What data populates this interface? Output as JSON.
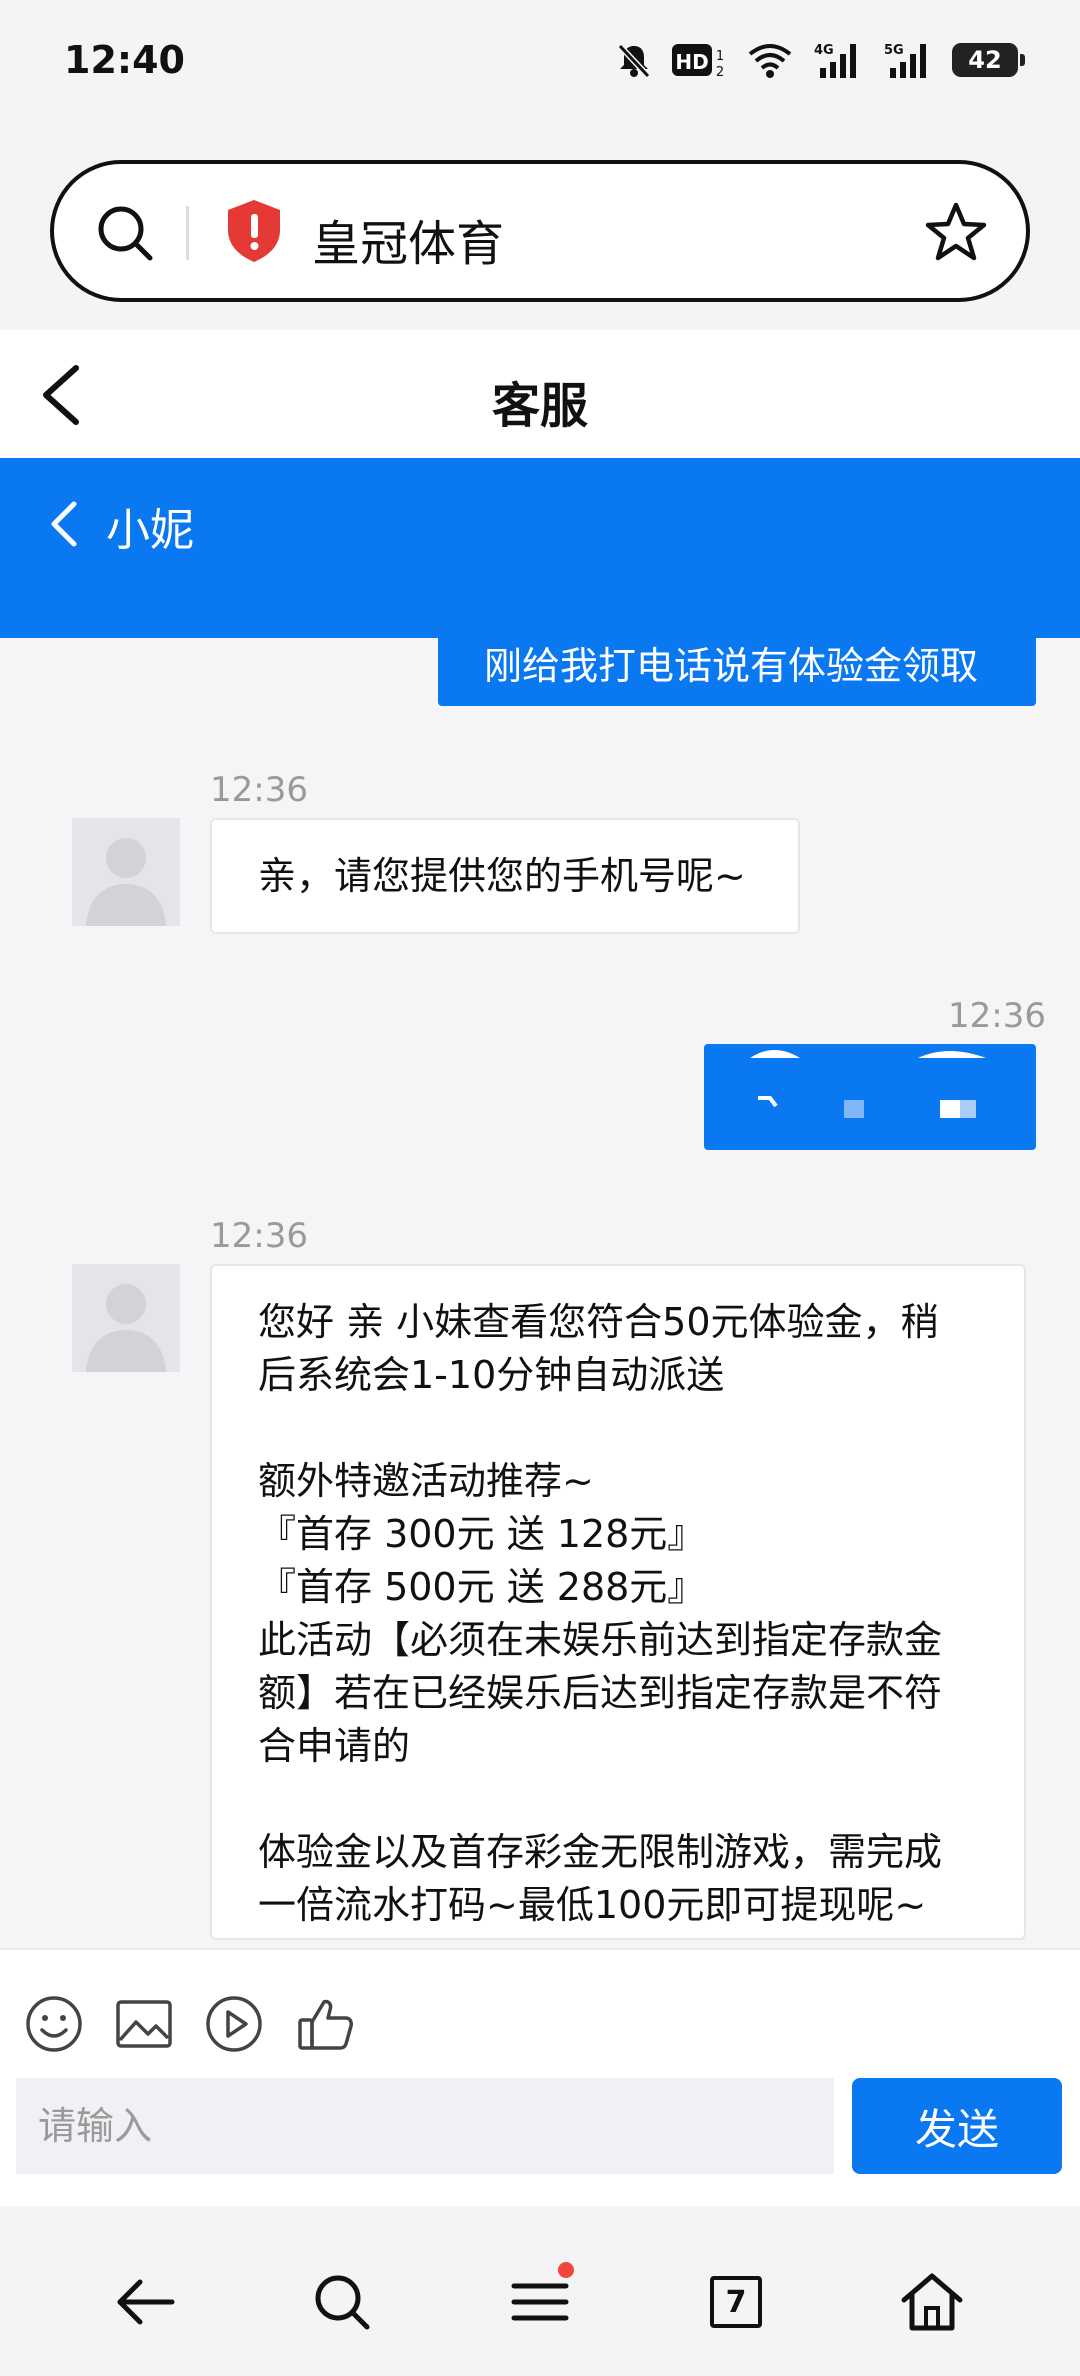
{
  "status_bar": {
    "time": "12:40",
    "battery": "42",
    "network_labels": [
      "HD",
      "4G",
      "5G"
    ]
  },
  "browser": {
    "url_text": "皇冠体育",
    "shield_color": "#e53935"
  },
  "page": {
    "title": "客服"
  },
  "chat": {
    "contact_name": "小妮",
    "accent_color": "#0a78f0",
    "messages": [
      {
        "side": "right",
        "text": "刚给我打电话说有体验金领取"
      },
      {
        "side": "left",
        "time": "12:36",
        "text": "亲，请您提供您的手机号呢~"
      },
      {
        "side": "right",
        "time": "12:36",
        "text": ""
      },
      {
        "side": "left",
        "time": "12:36",
        "text": "您好 亲 小妹查看您符合50元体验金，稍\n后系统会1-10分钟自动派送\n\n额外特邀活动推荐~\n『首存 300元 送 128元』\n『首存 500元 送 288元』\n此活动【必须在未娱乐前达到指定存款金\n额】若在已经娱乐后达到指定存款是不符\n合申请的\n\n体验金以及首存彩金无限制游戏，需完成\n一倍流水打码~最低100元即可提现呢~"
      }
    ]
  },
  "input": {
    "placeholder": "请输入",
    "send_label": "发送",
    "tools": [
      "emoji-icon",
      "image-icon",
      "video-icon",
      "thumbs-up-icon"
    ]
  },
  "bottom_nav": {
    "items": [
      "back-icon",
      "search-icon",
      "menu-icon",
      "tabs-icon",
      "home-icon"
    ],
    "tab_count": "7"
  }
}
